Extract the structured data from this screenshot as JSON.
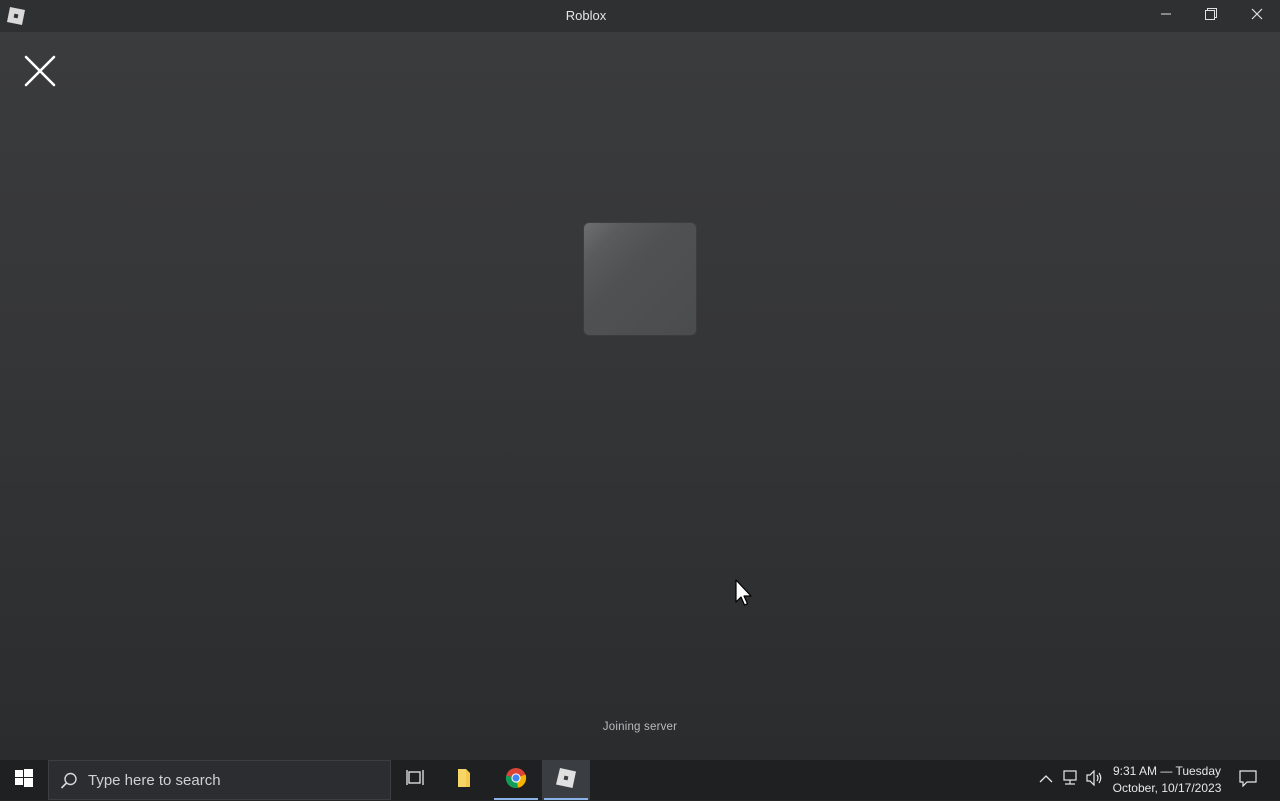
{
  "window": {
    "title": "Roblox",
    "app_icon": "roblox-logo-icon",
    "controls": {
      "minimize_icon": "minimize-icon",
      "restore_icon": "restore-icon",
      "close_icon": "close-icon"
    }
  },
  "loading_screen": {
    "close_icon": "close-x-icon",
    "tile_icon": "game-thumbnail-placeholder",
    "status": "Joining server"
  },
  "taskbar": {
    "start_icon": "windows-start-icon",
    "search": {
      "placeholder": "Type here to search",
      "icon": "search-icon"
    },
    "pinned": [
      {
        "name": "task-view",
        "icon": "task-view-icon"
      },
      {
        "name": "file-explorer",
        "icon": "folder-icon"
      },
      {
        "name": "chrome",
        "icon": "chrome-icon"
      },
      {
        "name": "roblox",
        "icon": "roblox-icon",
        "active": true
      }
    ],
    "tray": {
      "chevron_icon": "chevron-up-icon",
      "network_icon": "network-icon",
      "volume_icon": "volume-icon",
      "time": "9:31 AM — Tuesday",
      "date": "October, 10/17/2023",
      "notification_icon": "notification-icon"
    }
  },
  "colors": {
    "background_top": "#3b3c3e",
    "background_bottom": "#2a2c2e",
    "taskbar": "#1e2022",
    "active_indicator": "#8ab4e8"
  }
}
